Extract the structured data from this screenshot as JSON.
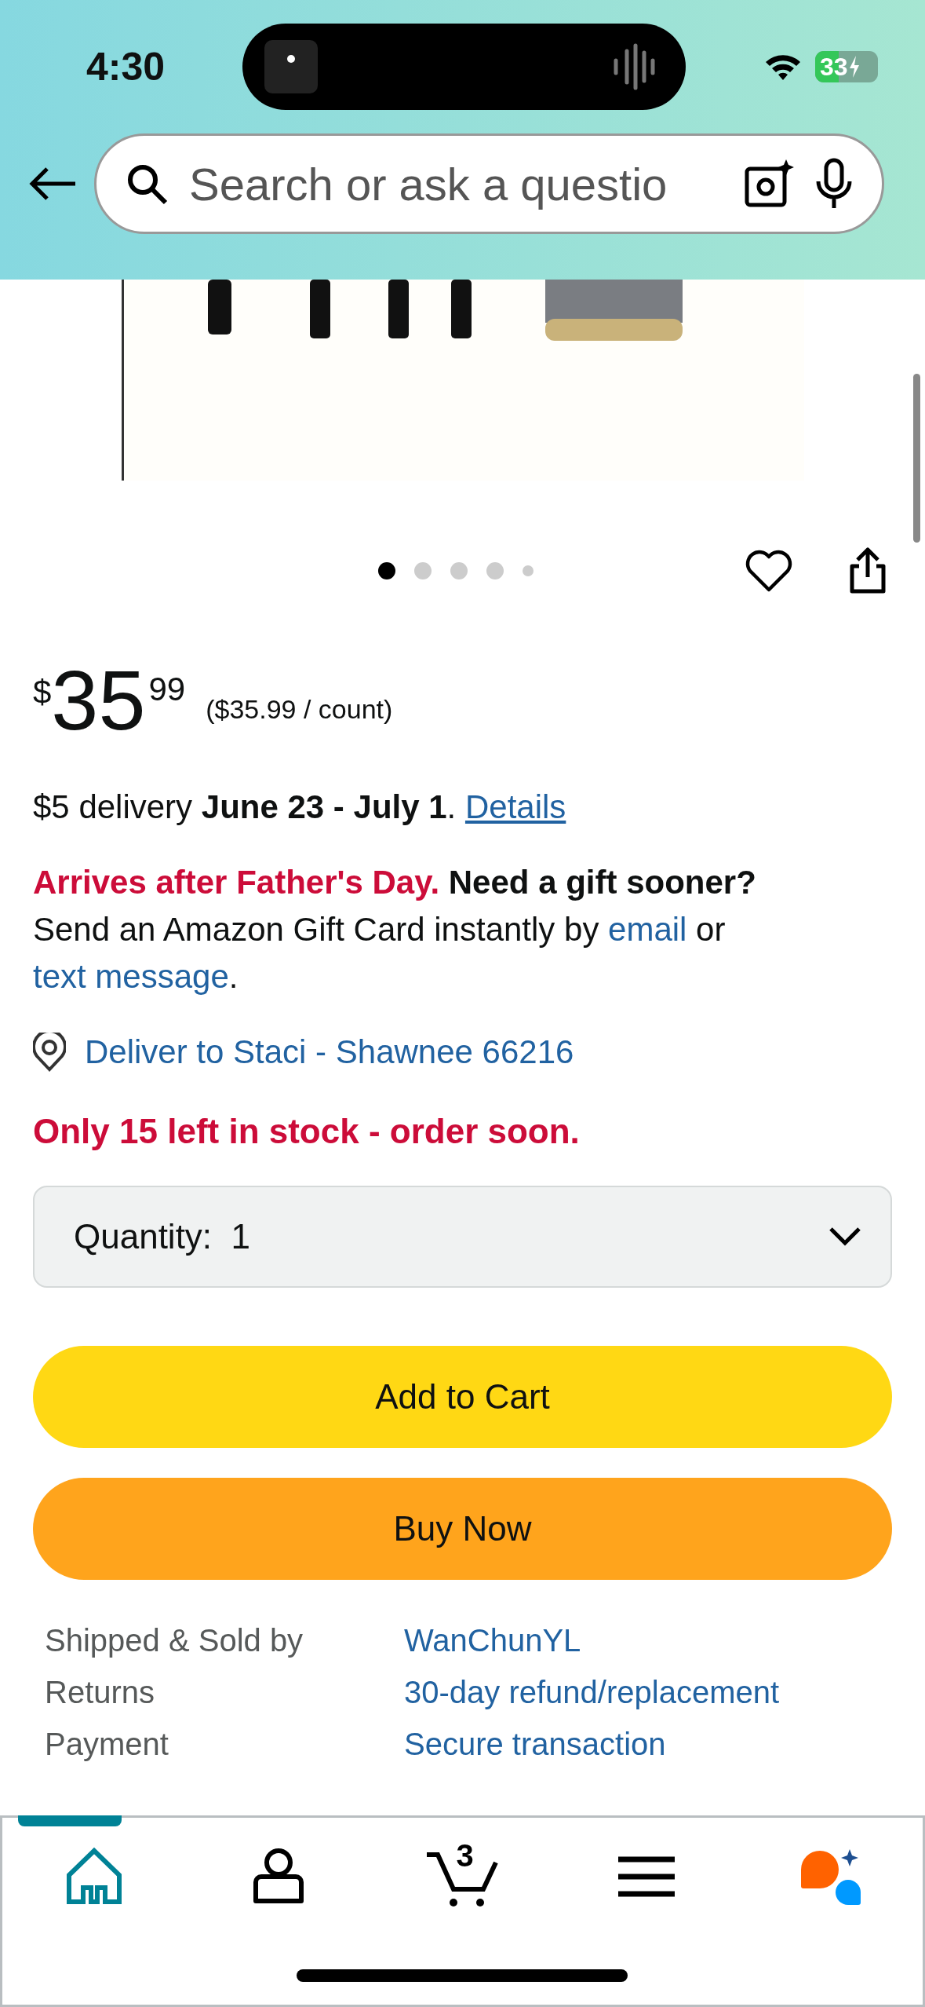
{
  "status_bar": {
    "time": "4:30",
    "battery": "33"
  },
  "search": {
    "placeholder": "Search or ask a questio"
  },
  "image_dots": [
    {
      "selected": true
    },
    {
      "selected": false
    },
    {
      "selected": false
    },
    {
      "selected": false
    },
    {
      "selected": false
    }
  ],
  "price": {
    "currency": "$",
    "whole": "35",
    "fraction": "99",
    "unit_price": "($35.99 / count)"
  },
  "delivery": {
    "text": "$5 delivery **June 23 - July 1**.",
    "link": "Details"
  },
  "gift_notice": [
    {
      "kind": "alert",
      "text": "Arrives after Father's Day."
    },
    {
      "kind": "bold",
      "text": " Need a gift sooner?"
    },
    {
      "kind": "plain",
      "text": " Send an Amazon Gift Card instantly by "
    },
    {
      "kind": "link",
      "text": "email"
    },
    {
      "kind": "plain",
      "text": " or "
    },
    {
      "kind": "link",
      "text": "text message"
    },
    {
      "kind": "plain",
      "text": "."
    }
  ],
  "deliver_to": "Deliver to Staci - Shawnee 66216",
  "stock": "Only 15 left in stock - order soon.",
  "quantity": {
    "label": "Quantity:",
    "value": "1"
  },
  "buttons": [
    {
      "kind": "cart",
      "label": "Add to Cart"
    },
    {
      "kind": "buy",
      "label": "Buy Now"
    }
  ],
  "details": [
    {
      "label": "Shipped & Sold by",
      "value": "WanChunYL"
    },
    {
      "label": "Returns",
      "value": "30-day refund/replacement"
    },
    {
      "label": "Payment",
      "value": "Secure transaction"
    }
  ],
  "tab_bar": [
    {
      "kind": "home",
      "selected": true
    },
    {
      "kind": "account",
      "selected": false
    },
    {
      "kind": "cart",
      "selected": false,
      "badge": "3"
    },
    {
      "kind": "menu",
      "selected": false
    },
    {
      "kind": "assistant",
      "selected": false
    }
  ]
}
